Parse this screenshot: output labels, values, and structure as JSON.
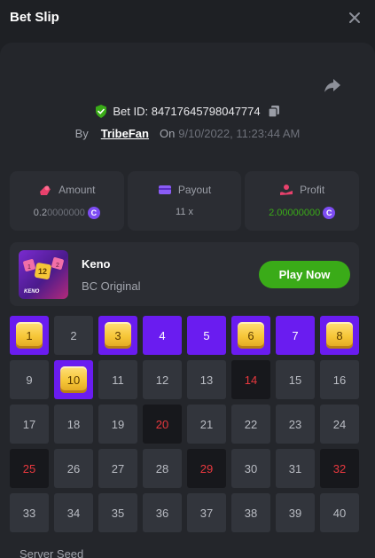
{
  "header": {
    "title": "Bet Slip"
  },
  "bet": {
    "id_text": "Bet ID: 84717645798047774",
    "by_label": "By",
    "user": "TribeFan",
    "on_label": "On",
    "date": "9/10/2022, 11:23:44 AM"
  },
  "stats": {
    "amount": {
      "label": "Amount",
      "value_main": "0.2",
      "value_rest": "0000000",
      "value_color": "#a3a6ae"
    },
    "payout": {
      "label": "Payout",
      "value": "11 x"
    },
    "profit": {
      "label": "Profit",
      "value_main": "2.",
      "value_rest": "00000000",
      "value_color": "#3aab18"
    }
  },
  "game": {
    "name": "Keno",
    "provider": "BC Original",
    "play_label": "Play Now",
    "thumb_text": "KENO",
    "dice": [
      "1",
      "12",
      "2"
    ]
  },
  "coin_symbol": "C",
  "grid": {
    "cells": [
      {
        "n": "1",
        "state": "picked-hit"
      },
      {
        "n": "2",
        "state": "normal"
      },
      {
        "n": "3",
        "state": "picked-hit"
      },
      {
        "n": "4",
        "state": "picked"
      },
      {
        "n": "5",
        "state": "picked"
      },
      {
        "n": "6",
        "state": "picked-hit"
      },
      {
        "n": "7",
        "state": "picked"
      },
      {
        "n": "8",
        "state": "picked-hit"
      },
      {
        "n": "9",
        "state": "normal"
      },
      {
        "n": "10",
        "state": "picked-hit"
      },
      {
        "n": "11",
        "state": "normal"
      },
      {
        "n": "12",
        "state": "normal"
      },
      {
        "n": "13",
        "state": "normal"
      },
      {
        "n": "14",
        "state": "drawn"
      },
      {
        "n": "15",
        "state": "normal"
      },
      {
        "n": "16",
        "state": "normal"
      },
      {
        "n": "17",
        "state": "normal"
      },
      {
        "n": "18",
        "state": "normal"
      },
      {
        "n": "19",
        "state": "normal"
      },
      {
        "n": "20",
        "state": "drawn"
      },
      {
        "n": "21",
        "state": "normal"
      },
      {
        "n": "22",
        "state": "normal"
      },
      {
        "n": "23",
        "state": "normal"
      },
      {
        "n": "24",
        "state": "normal"
      },
      {
        "n": "25",
        "state": "drawn"
      },
      {
        "n": "26",
        "state": "normal"
      },
      {
        "n": "27",
        "state": "normal"
      },
      {
        "n": "28",
        "state": "normal"
      },
      {
        "n": "29",
        "state": "drawn"
      },
      {
        "n": "30",
        "state": "normal"
      },
      {
        "n": "31",
        "state": "normal"
      },
      {
        "n": "32",
        "state": "drawn"
      },
      {
        "n": "33",
        "state": "normal"
      },
      {
        "n": "34",
        "state": "normal"
      },
      {
        "n": "35",
        "state": "normal"
      },
      {
        "n": "36",
        "state": "normal"
      },
      {
        "n": "37",
        "state": "normal"
      },
      {
        "n": "38",
        "state": "normal"
      },
      {
        "n": "39",
        "state": "normal"
      },
      {
        "n": "40",
        "state": "normal"
      }
    ]
  },
  "footer": {
    "server_seed_label": "Server Seed"
  },
  "colors": {
    "accent_purple": "#6a1cf0",
    "green": "#3aab18",
    "hit_red": "#e8383e",
    "gold": "#f6c637"
  },
  "icons": [
    "close-icon",
    "share-icon",
    "shield-check-icon",
    "copy-icon",
    "amount-icon",
    "payout-icon",
    "profit-icon",
    "coin-icon"
  ]
}
